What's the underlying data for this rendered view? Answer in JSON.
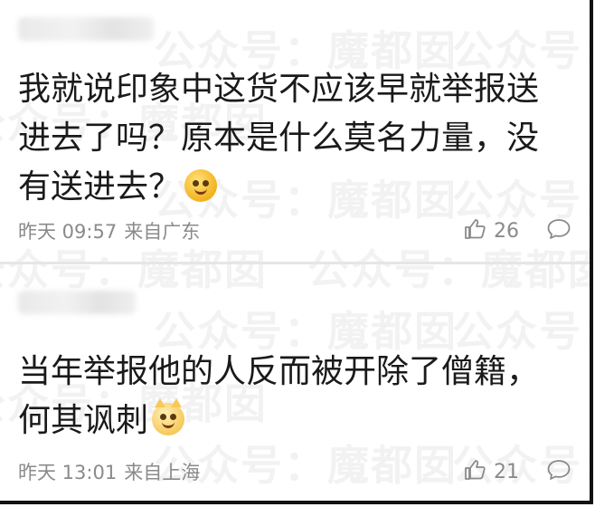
{
  "watermark": {
    "text": "公众号：魔都囡"
  },
  "comments": [
    {
      "author_name": "",
      "text": "我就说印象中这货不应该早就举报送进去了吗？原本是什么莫名力量，没有送进去？",
      "emoji": "dizzy-face-emoji",
      "time": "昨天 09:57",
      "location": "来自广东",
      "likes": "26"
    },
    {
      "author_name": "",
      "text": "当年举报他的人反而被开除了僧籍，何其讽刺",
      "emoji": "cat-face-emoji",
      "time": "昨天 13:01",
      "location": "来自上海",
      "likes": "21"
    }
  ],
  "colors": {
    "text": "#1a1a1a",
    "meta": "#8a8a8a",
    "divider": "#e6e6e6",
    "frame": "#111111"
  }
}
